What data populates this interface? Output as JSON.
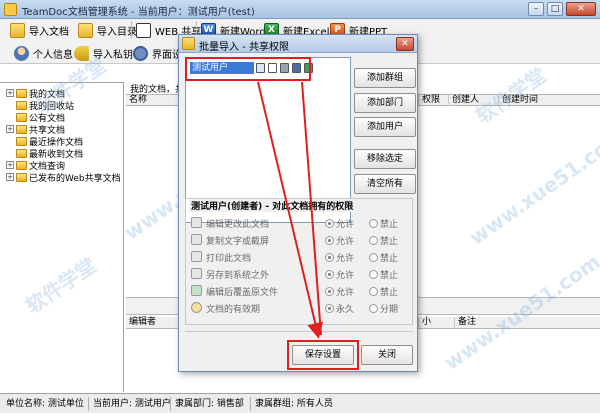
{
  "window": {
    "title": "TeamDoc文档管理系统 - 当前用户：测试用户(test)",
    "controls": [
      "minimize",
      "maximize",
      "close"
    ]
  },
  "toolbar": {
    "row1": [
      {
        "label": "导入文档",
        "icon": "import-doc-icon"
      },
      {
        "label": "导入目录",
        "icon": "import-folder-icon"
      },
      {
        "label": "WEB 共享",
        "icon": "web-share-icon"
      },
      {
        "label": "新建Word",
        "icon": "word-icon",
        "glyph": "W"
      },
      {
        "label": "新建Excel",
        "icon": "excel-icon",
        "glyph": "X"
      },
      {
        "label": "新建PPT",
        "icon": "ppt-icon",
        "glyph": "P"
      }
    ],
    "row2": [
      {
        "label": "个人信息",
        "icon": "user-icon"
      },
      {
        "label": "导入私钥",
        "icon": "key-icon"
      },
      {
        "label": "界面设",
        "icon": "settings-icon"
      }
    ]
  },
  "tree": {
    "items": [
      {
        "label": "我的文档",
        "expander": "+"
      },
      {
        "label": "我的回收站",
        "expander": ""
      },
      {
        "label": "公有文档",
        "expander": ""
      },
      {
        "label": "共享文档",
        "expander": "+"
      },
      {
        "label": "最近操作文档",
        "expander": ""
      },
      {
        "label": "最新收到文档",
        "expander": ""
      },
      {
        "label": "文档查询",
        "expander": "+"
      },
      {
        "label": "已发布的Web共享文档",
        "expander": "+"
      }
    ]
  },
  "main": {
    "path_label": "我的文档，共",
    "columns": [
      "名称",
      "权限",
      "创建人",
      "创建时间"
    ],
    "detail_columns": [
      "编辑者",
      "小",
      "备注"
    ]
  },
  "status": {
    "unit": "单位名称: 测试单位",
    "user": "当前用户: 测试用户",
    "dept": "隶属部门: 销售部",
    "group": "隶属群组: 所有人员"
  },
  "dialog": {
    "title": "批量导入 - 共享权限",
    "share_entry": "测试用户",
    "buttons": {
      "add_group": "添加群组",
      "add_dept": "添加部门",
      "add_user": "添加用户",
      "remove": "移除选定",
      "clear": "清空所有",
      "save": "保存设置",
      "close": "关闭"
    },
    "perm_title": "测试用户(创建者) - 对此文档拥有的权限",
    "permissions": [
      {
        "label": "编辑更改此文档",
        "opt1": "允许",
        "opt2": "禁止",
        "selected": 1
      },
      {
        "label": "复制文字或截屏",
        "opt1": "允许",
        "opt2": "禁止",
        "selected": 1
      },
      {
        "label": "打印此文档",
        "opt1": "允许",
        "opt2": "禁止",
        "selected": 1
      },
      {
        "label": "另存到系统之外",
        "opt1": "允许",
        "opt2": "禁止",
        "selected": 1
      },
      {
        "label": "编辑后覆盖原文件",
        "opt1": "允许",
        "opt2": "禁止",
        "selected": 1
      },
      {
        "label": "文档的有效期",
        "opt1": "永久",
        "opt2": "分期",
        "selected": 1
      }
    ]
  },
  "watermarks": [
    "软件学堂",
    "www.xue51.com",
    "软件学堂",
    "www.xue51.com",
    "软件学堂",
    "www.xue51.com"
  ],
  "colors": {
    "highlight_box": "#e02020",
    "selection": "#3a7bd5",
    "titlebar": "#b5cbe8"
  }
}
